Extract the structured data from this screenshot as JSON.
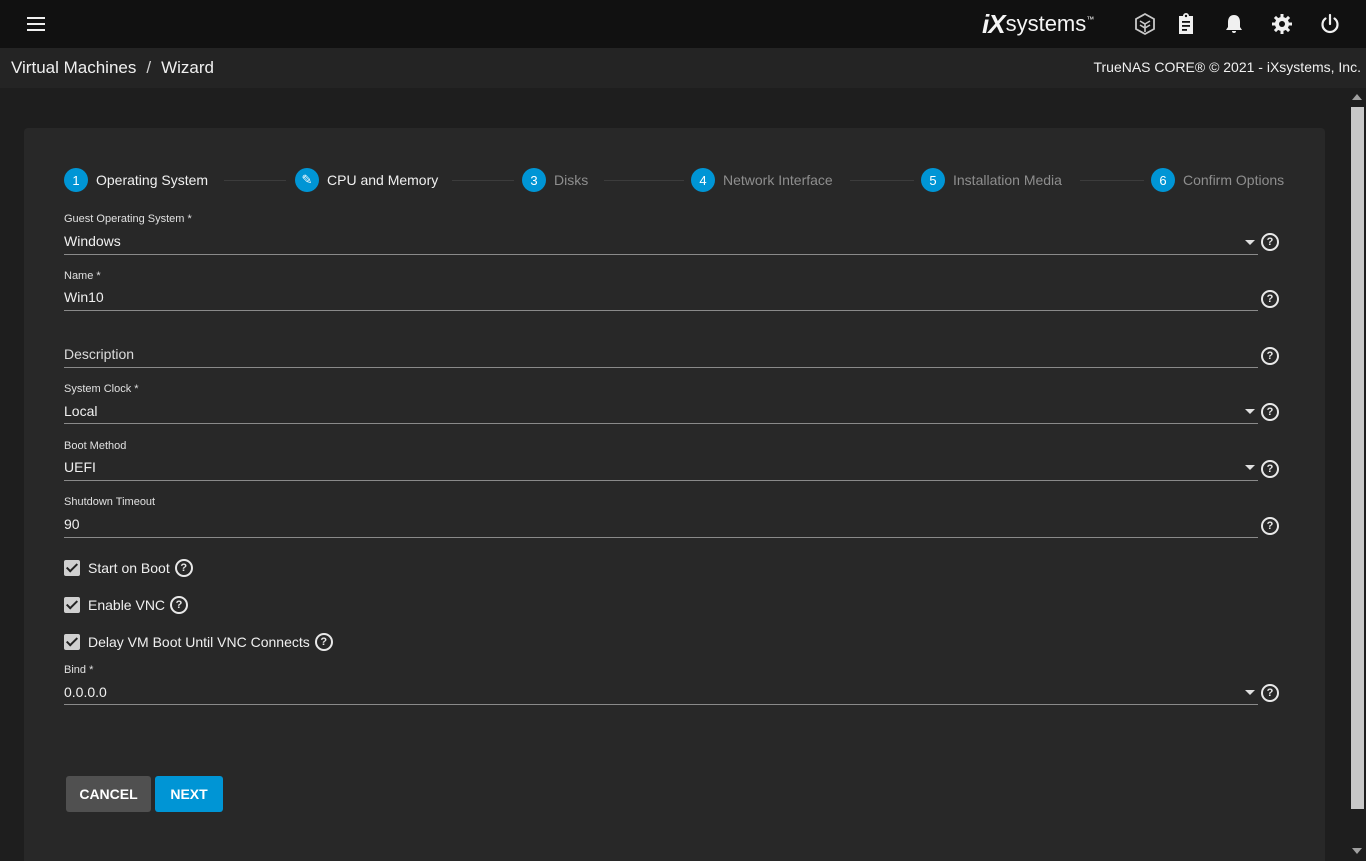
{
  "header": {
    "logo_mark": "iX",
    "logo_word": "systems",
    "logo_tm": "™",
    "icons": [
      "hamburger-icon",
      "truecommand-icon",
      "clipboard-icon",
      "bell-icon",
      "gear-icon",
      "power-icon"
    ]
  },
  "breadcrumb": {
    "items": [
      "Virtual Machines",
      "Wizard"
    ],
    "separator": "/"
  },
  "copyright": "TrueNAS CORE® © 2021 - iXsystems, Inc.",
  "colors": {
    "accent": "#0095d5",
    "topbar": "#111111",
    "card": "#282828",
    "background": "#1e1e1e"
  },
  "steps": [
    {
      "badge": "1",
      "label": "Operating System",
      "active": true
    },
    {
      "badge": "✎",
      "label": "CPU and Memory",
      "active": true
    },
    {
      "badge": "3",
      "label": "Disks",
      "active": false
    },
    {
      "badge": "4",
      "label": "Network Interface",
      "active": false
    },
    {
      "badge": "5",
      "label": "Installation Media",
      "active": false
    },
    {
      "badge": "6",
      "label": "Confirm Options",
      "active": false
    }
  ],
  "form": {
    "guest_os": {
      "label": "Guest Operating System *",
      "value": "Windows"
    },
    "name": {
      "label": "Name *",
      "value": "Win10"
    },
    "description": {
      "placeholder": "Description"
    },
    "system_clock": {
      "label": "System Clock *",
      "value": "Local"
    },
    "boot_method": {
      "label": "Boot Method",
      "value": "UEFI"
    },
    "shutdown_timeout": {
      "label": "Shutdown Timeout",
      "value": "90"
    },
    "start_on_boot": {
      "label": "Start on Boot",
      "checked": true
    },
    "enable_vnc": {
      "label": "Enable VNC",
      "checked": true
    },
    "delay_vm_boot": {
      "label": "Delay VM Boot Until VNC Connects",
      "checked": true
    },
    "bind": {
      "label": "Bind *",
      "value": "0.0.0.0"
    },
    "help_glyph": "?"
  },
  "buttons": {
    "cancel": "CANCEL",
    "next": "NEXT"
  }
}
